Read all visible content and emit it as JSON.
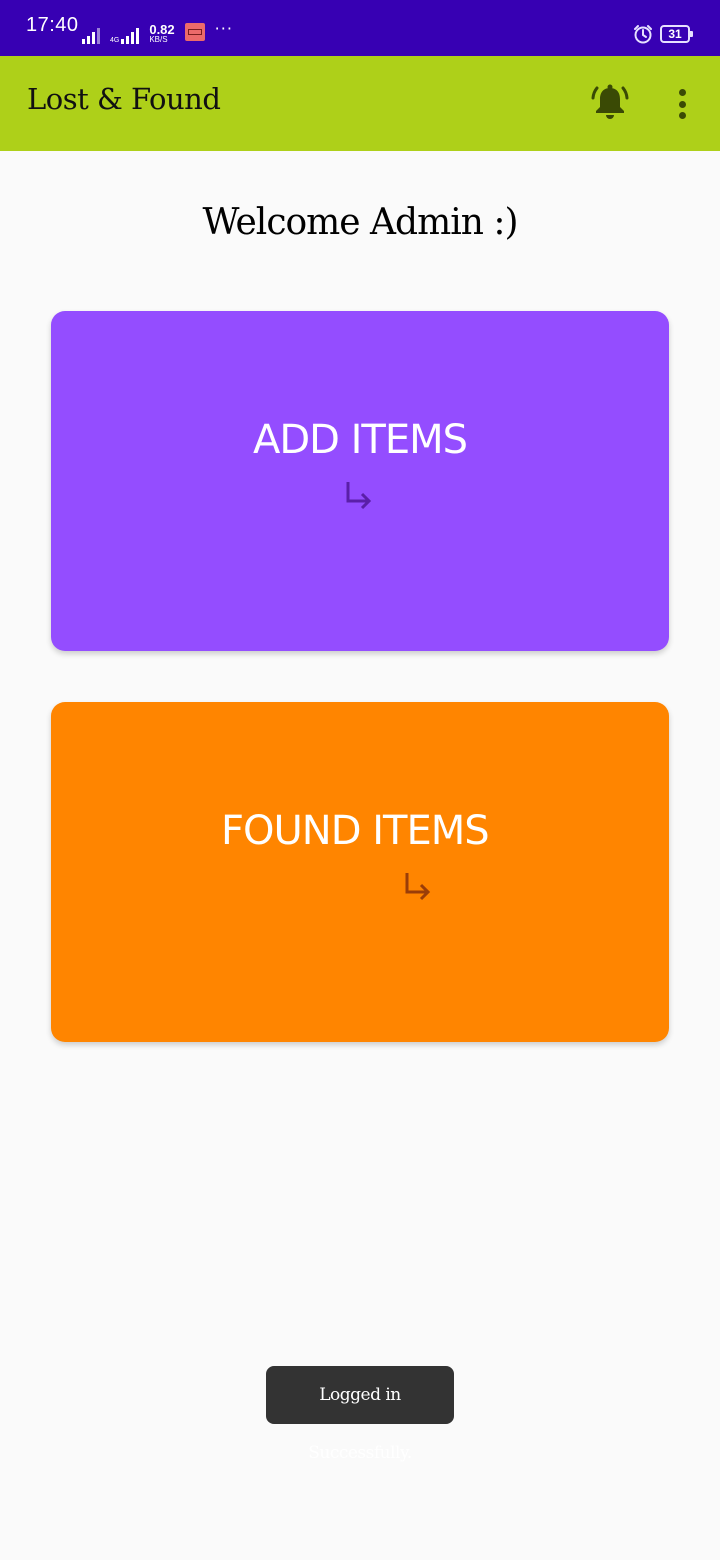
{
  "status_bar": {
    "time": "17:40",
    "network_type": "4G",
    "speed_value": "0.82",
    "speed_unit": "KB/S",
    "more": "···",
    "battery": "31",
    "icons": [
      "signal-icon",
      "signal-4g-icon",
      "app-notification-icon",
      "alarm-icon",
      "battery-icon"
    ]
  },
  "app_bar": {
    "title": "Lost & Found",
    "background_color": "#aed019",
    "icons": [
      "notification-bell-icon",
      "overflow-menu-icon"
    ]
  },
  "main": {
    "welcome_text": "Welcome Admin :)",
    "cards": [
      {
        "label": "ADD ITEMS",
        "color": "#944dff",
        "icon": "arrow-return-icon"
      },
      {
        "label": "FOUND ITEMS",
        "color": "#ff8500",
        "icon": "arrow-return-icon"
      }
    ]
  },
  "toast": {
    "message": "Logged in Successfully."
  }
}
